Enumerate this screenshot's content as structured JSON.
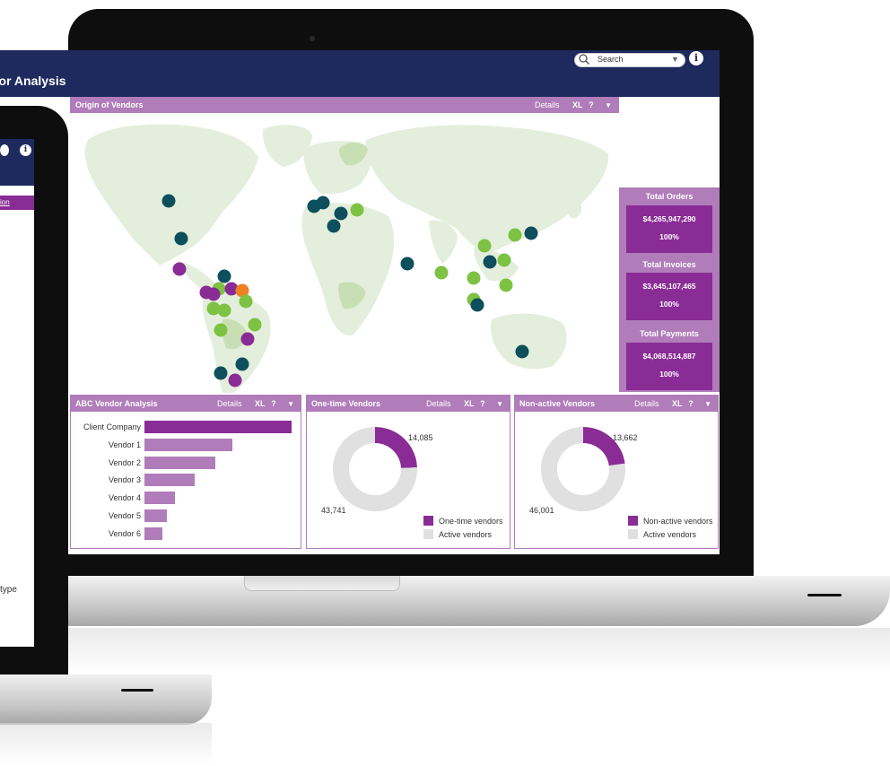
{
  "app": {
    "title": "dor Analysis",
    "search_placeholder": "Search",
    "info_glyph": "i"
  },
  "map_panel": {
    "title": "Origin of Vendors",
    "details": "Details",
    "export": "XL",
    "help": "?",
    "marker_colors": {
      "teal": "#0d4f5c",
      "green": "#7dc242",
      "purple": "#8a2c96",
      "orange": "#f08120"
    }
  },
  "kpis": [
    {
      "label": "Total Orders",
      "value": "$4,265,947,290",
      "percent": "100%"
    },
    {
      "label": "Total Invoices",
      "value": "$3,645,107,465",
      "percent": "100%"
    },
    {
      "label": "Total Payments",
      "value": "$4,068,514,887",
      "percent": "100%"
    }
  ],
  "abc_panel": {
    "title": "ABC Vendor Analysis",
    "details": "Details",
    "export": "XL",
    "help": "?",
    "chart_data": {
      "type": "bar",
      "orientation": "horizontal",
      "categories": [
        "Client Company",
        "Vendor 1",
        "Vendor 2",
        "Vendor 3",
        "Vendor 4",
        "Vendor 5",
        "Vendor 6"
      ],
      "values": [
        100,
        60,
        48,
        34,
        21,
        15,
        12
      ],
      "colors": [
        "#8a2c96",
        "#b07cba",
        "#b07cba",
        "#b07cba",
        "#b07cba",
        "#b07cba",
        "#b07cba"
      ]
    }
  },
  "onetime_panel": {
    "title": "One-time Vendors",
    "details": "Details",
    "export": "XL",
    "help": "?",
    "chart_data": {
      "type": "pie",
      "labels": [
        "One-time vendors",
        "Active vendors"
      ],
      "values": [
        14085,
        43741
      ],
      "value_labels": [
        "14,085",
        "43,741"
      ],
      "colors": [
        "#8a2c96",
        "#e0e0e0"
      ]
    }
  },
  "nonactive_panel": {
    "title": "Non-active Vendors",
    "details": "Details",
    "export": "XL",
    "help": "?",
    "chart_data": {
      "type": "pie",
      "labels": [
        "Non-active vendors",
        "Active vendors"
      ],
      "values": [
        13662,
        46001
      ],
      "value_labels": [
        "13,662",
        "46,001"
      ],
      "colors": [
        "#8a2c96",
        "#e0e0e0"
      ]
    }
  },
  "tablet": {
    "link_text": "ion",
    "type_text": "type",
    "info_glyph": "i"
  }
}
